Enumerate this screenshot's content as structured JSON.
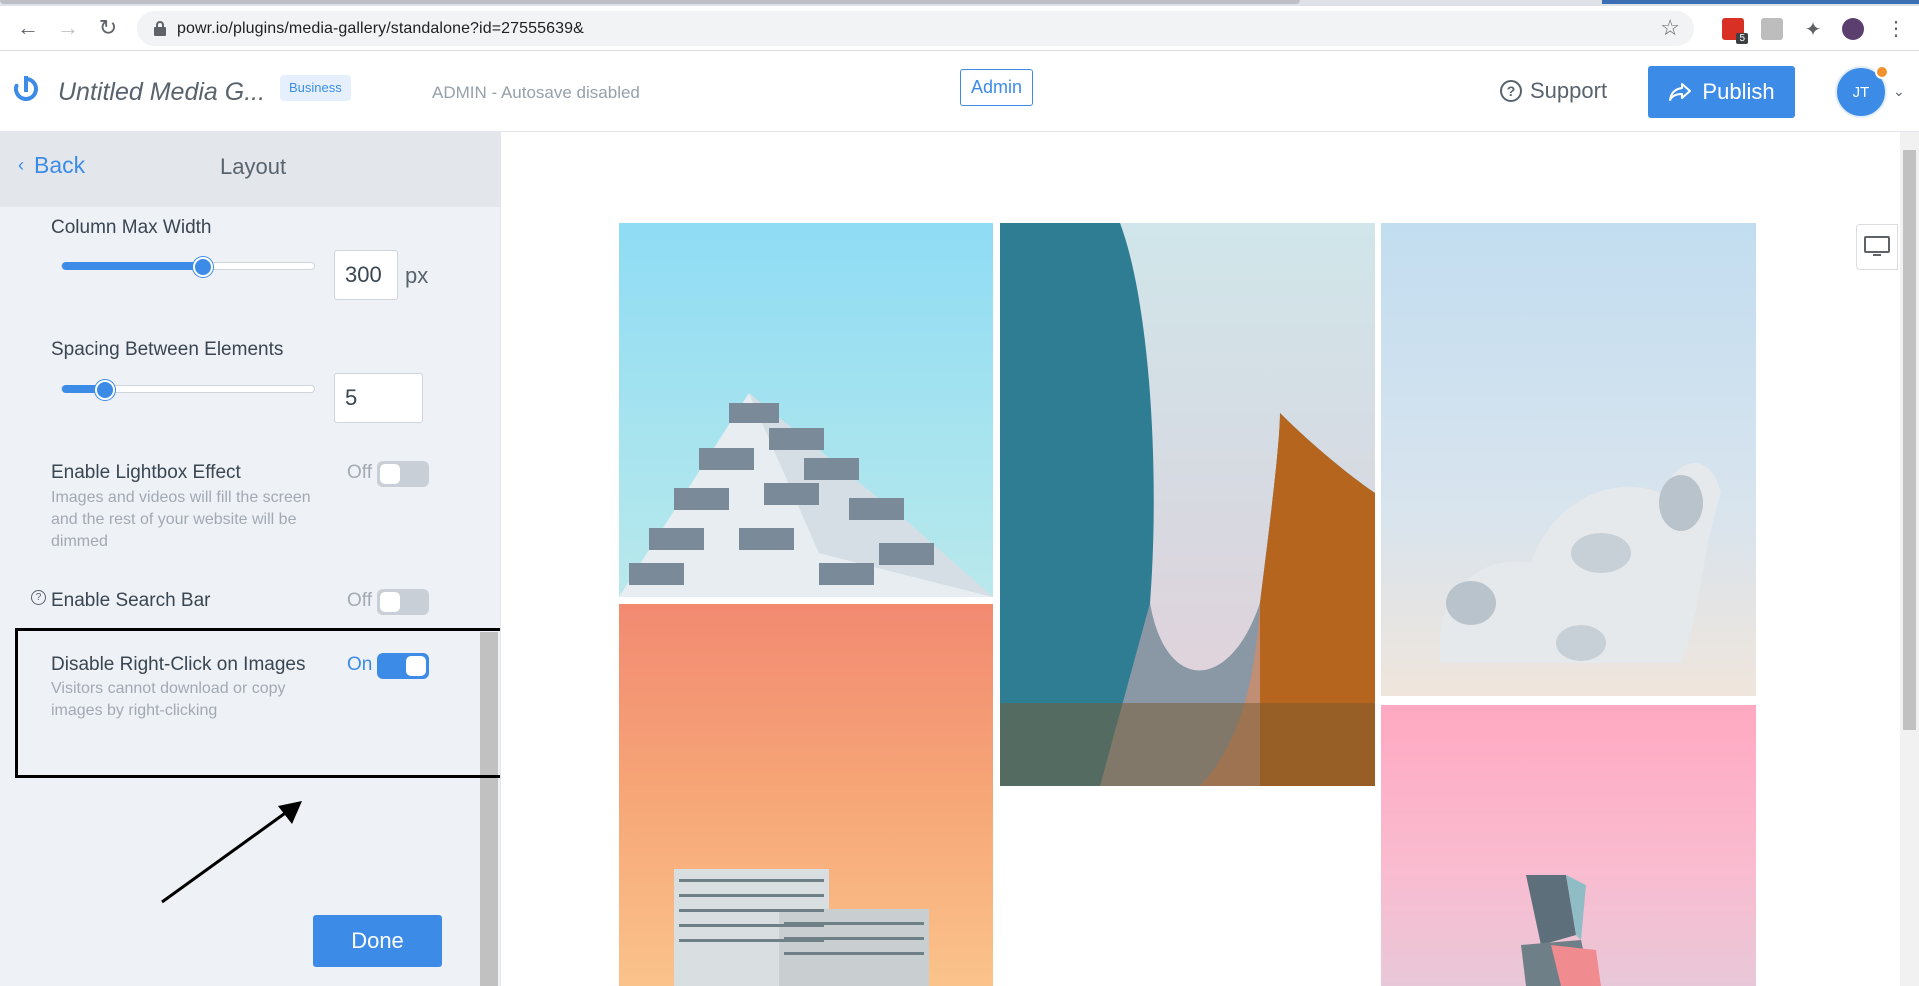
{
  "browser": {
    "url": "powr.io/plugins/media-gallery/standalone?id=27555639&",
    "extension_badge": "5"
  },
  "header": {
    "app_title": "Untitled Media G...",
    "plan_badge": "Business",
    "status_text": "ADMIN - Autosave disabled",
    "admin_label": "Admin",
    "support_label": "Support",
    "publish_label": "Publish",
    "avatar_initials": "JT"
  },
  "sidebar": {
    "back_label": "Back",
    "title": "Layout",
    "column_max_width": {
      "label": "Column Max Width",
      "value": "300",
      "unit": "px",
      "slider_fraction": 0.55
    },
    "spacing": {
      "label": "Spacing Between Elements",
      "value": "5",
      "slider_fraction": 0.17
    },
    "lightbox": {
      "label": "Enable Lightbox Effect",
      "description": "Images and videos will fill the screen and the rest of your website will be dimmed",
      "state": "Off"
    },
    "search_bar": {
      "label": "Enable Search Bar",
      "state": "Off"
    },
    "right_click": {
      "label": "Disable Right-Click on Images",
      "description": "Visitors cannot download or copy images by right-clicking",
      "state": "On"
    },
    "done_label": "Done"
  },
  "colors": {
    "accent": "#3c8ce7",
    "sidebar_bg": "#eef1f5"
  },
  "gallery": {
    "items": [
      "building-balconies-photo",
      "curved-glass-building-photo",
      "white-sculpture-photo",
      "orange-sky-building-photo",
      "pink-sky-tower-photo"
    ]
  }
}
